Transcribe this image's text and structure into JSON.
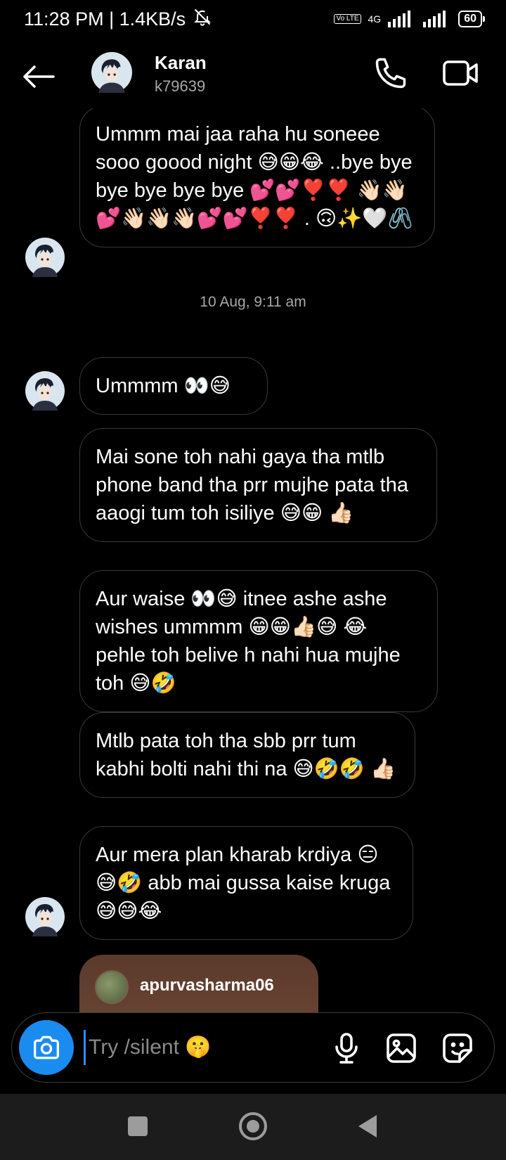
{
  "status_bar": {
    "time_speed": "11:28 PM | 1.4KB/s",
    "network": "4G",
    "volte": "Vo LTE",
    "battery": "60"
  },
  "header": {
    "name": "Karan",
    "username": "k79639"
  },
  "messages": [
    {
      "text": "Ummm  mai jaa raha hu soneee sooo goood night 😅😁😂 ..bye bye bye bye bye bye 💕💕❣️❣️ 👋🏻👋🏻💕👋🏻👋🏻👋🏻💕💕❣️❣️ . 🙃✨🤍🖇️"
    },
    {
      "timestamp": "10 Aug, 9:11 am"
    },
    {
      "text": "Ummmm 👀😅"
    },
    {
      "text": "Mai sone toh nahi gaya tha mtlb phone band tha prr mujhe pata tha aaogi tum toh isiliye 😅😁 👍🏻"
    },
    {
      "text": "Aur waise 👀😅 itnee ashe ashe wishes ummmm 😁😁👍🏻😅 😂 pehle toh belive h nahi hua mujhe toh 😅🤣"
    },
    {
      "text": "Mtlb pata toh tha sbb prr tum kabhi bolti nahi thi na 😅🤣🤣 👍🏻"
    },
    {
      "text": "Aur mera plan kharab krdiya 😑😅🤣 abb mai gussa kaise kruga 😅😅😂"
    }
  ],
  "shared_post": {
    "username": "apurvasharma06"
  },
  "composer": {
    "placeholder": "Try /silent 🤫"
  },
  "colors": {
    "accent": "#1a8cf0",
    "bubble_border": "#3a3a3a",
    "muted_text": "#a8a8a8"
  }
}
